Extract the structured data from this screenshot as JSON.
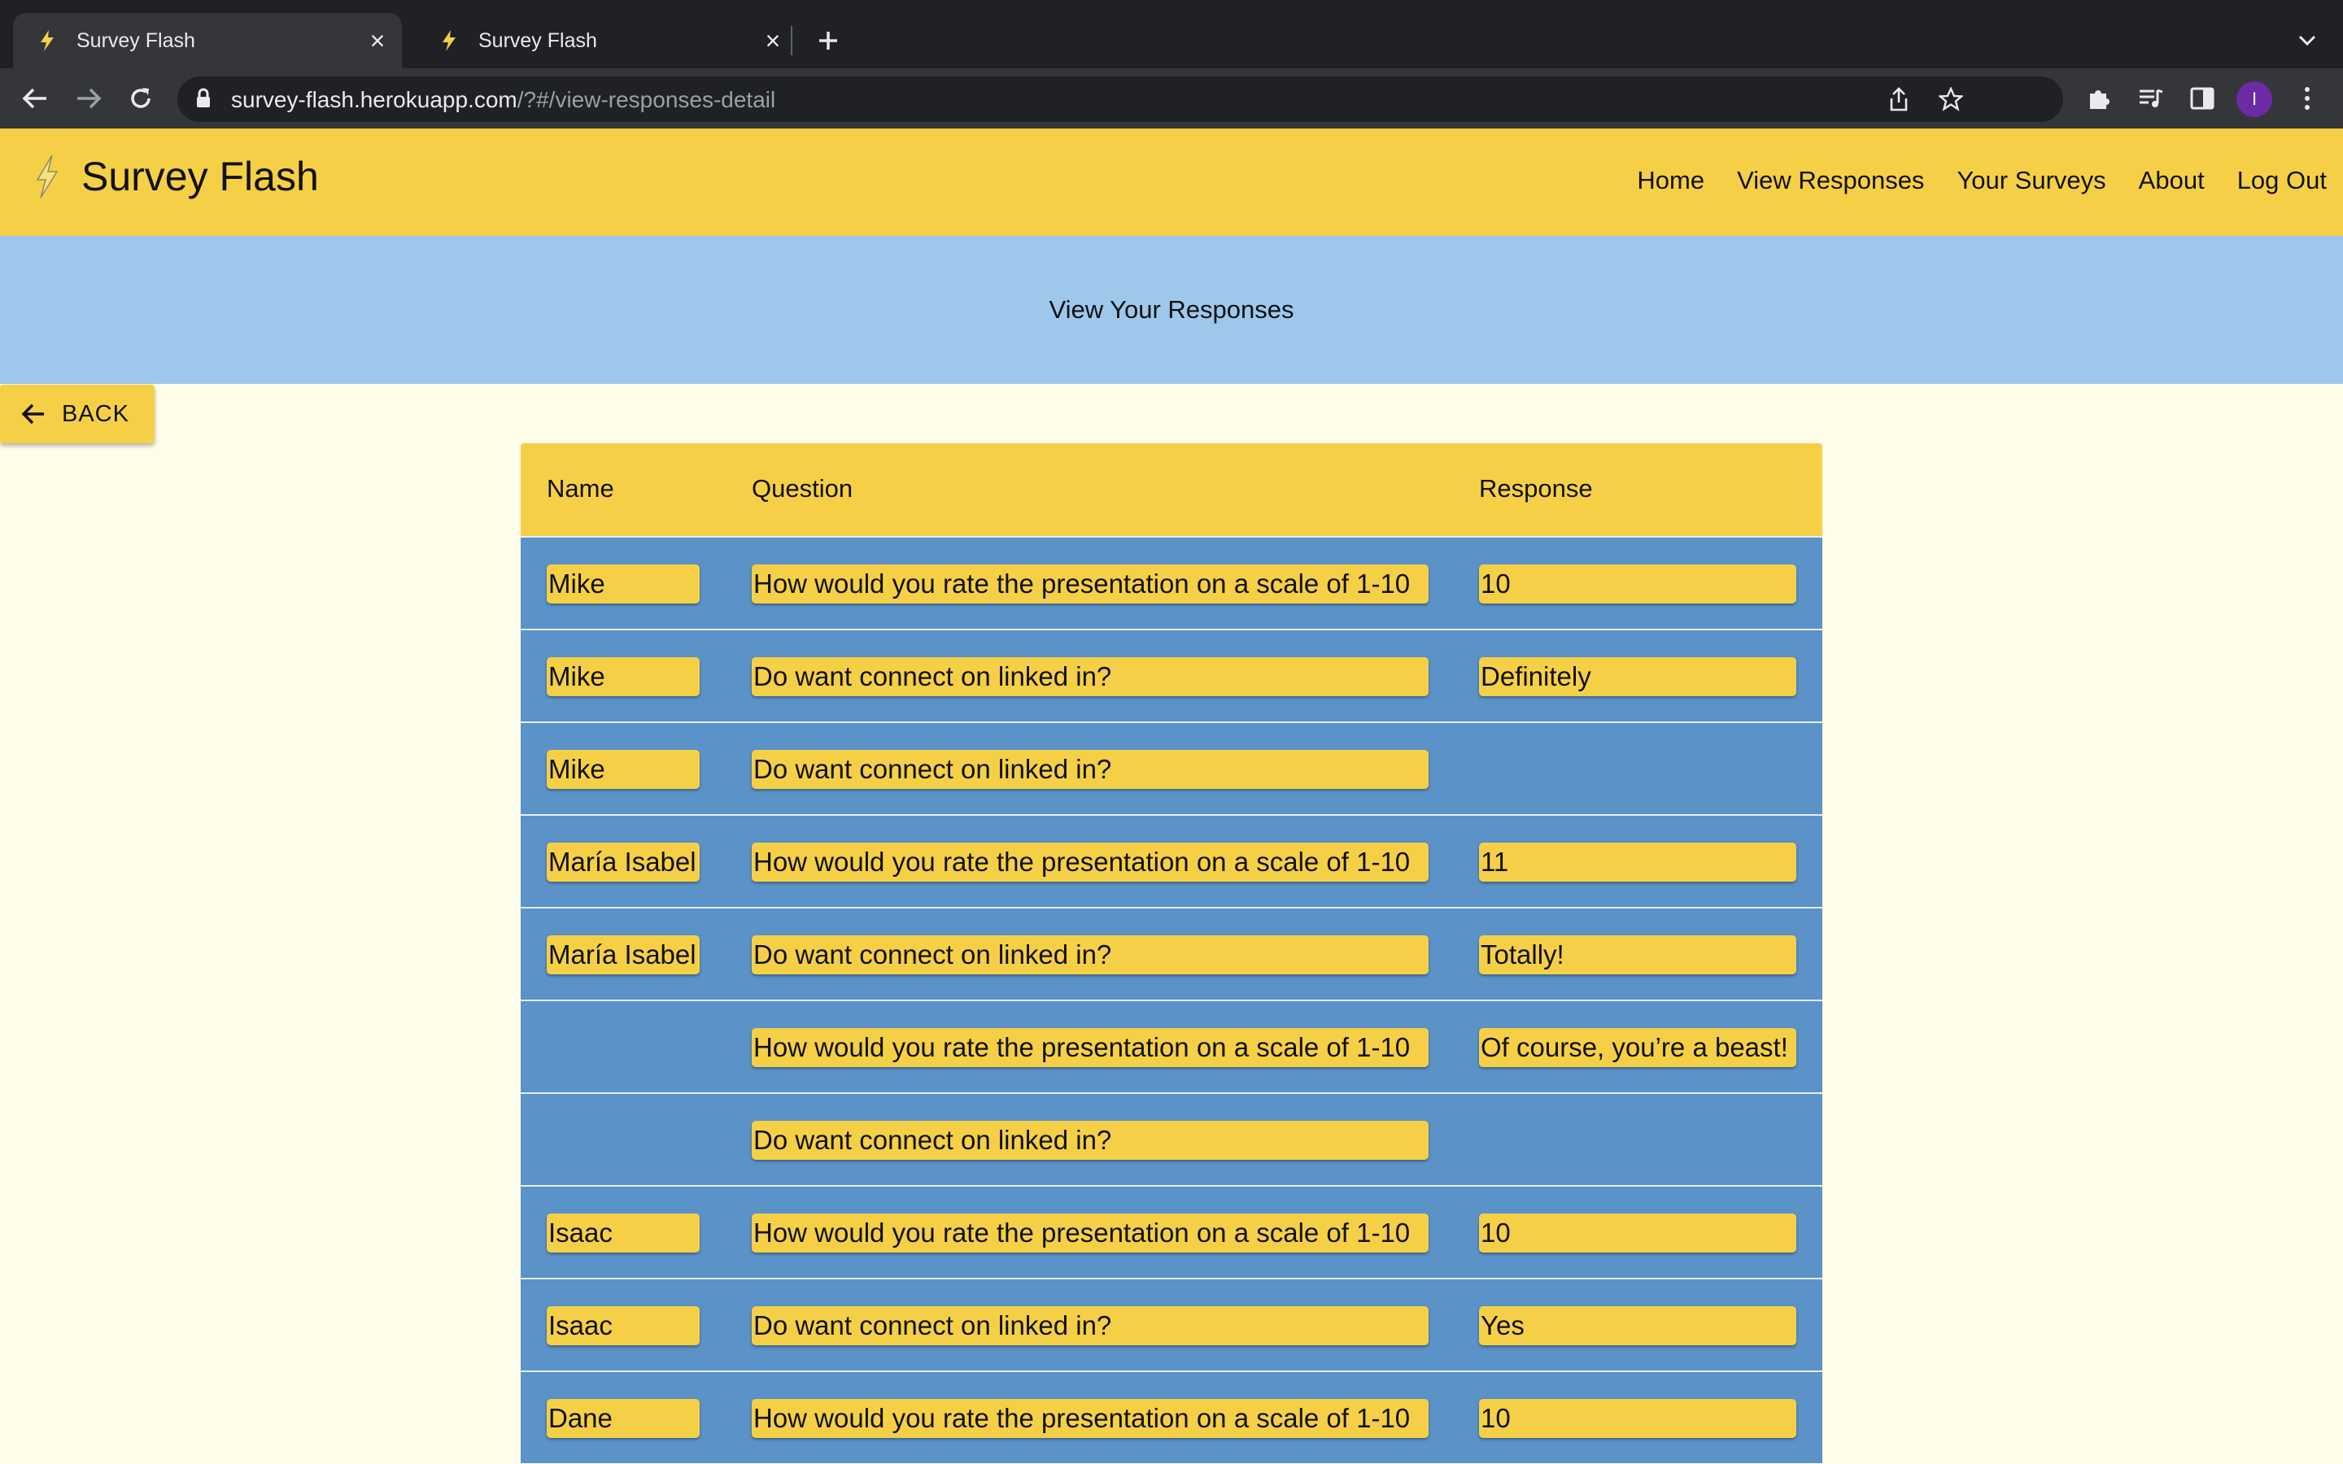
{
  "browser": {
    "tabs": [
      {
        "title": "Survey Flash",
        "active": true
      },
      {
        "title": "Survey Flash",
        "active": false
      }
    ],
    "url_host": "survey-flash.herokuapp.com",
    "url_path": "/?#/view-responses-detail",
    "profile_initial": "I"
  },
  "app": {
    "brand": "Survey Flash",
    "nav": [
      "Home",
      "View Responses",
      "Your Surveys",
      "About",
      "Log Out"
    ],
    "page_title": "View Your Responses",
    "back_label": "BACK"
  },
  "table": {
    "headers": [
      "Name",
      "Question",
      "Response"
    ],
    "rows": [
      {
        "name": "Mike",
        "question": "How would you rate the presentation on a scale of 1-10",
        "response": "10"
      },
      {
        "name": "Mike",
        "question": "Do want connect on linked in?",
        "response": "Definitely"
      },
      {
        "name": "Mike",
        "question": "Do want connect on linked in?",
        "response": ""
      },
      {
        "name": "María Isabel",
        "question": "How would you rate the presentation on a scale of 1-10",
        "response": "11"
      },
      {
        "name": "María Isabel",
        "question": "Do want connect on linked in?",
        "response": "Totally!"
      },
      {
        "name": "",
        "question": "How would you rate the presentation on a scale of 1-10",
        "response": "Of course, you’re a beast!"
      },
      {
        "name": "",
        "question": "Do want connect on linked in?",
        "response": ""
      },
      {
        "name": "Isaac",
        "question": "How would you rate the presentation on a scale of 1-10",
        "response": "10"
      },
      {
        "name": "Isaac",
        "question": "Do want connect on linked in?",
        "response": "Yes"
      },
      {
        "name": "Dane",
        "question": "How would you rate the presentation on a scale of 1-10",
        "response": "10"
      }
    ]
  },
  "colors": {
    "brand_yellow": "#f5d046",
    "hero_blue": "#9dc8eb",
    "row_blue": "#5b92c8",
    "page_bg": "#fffcea"
  }
}
